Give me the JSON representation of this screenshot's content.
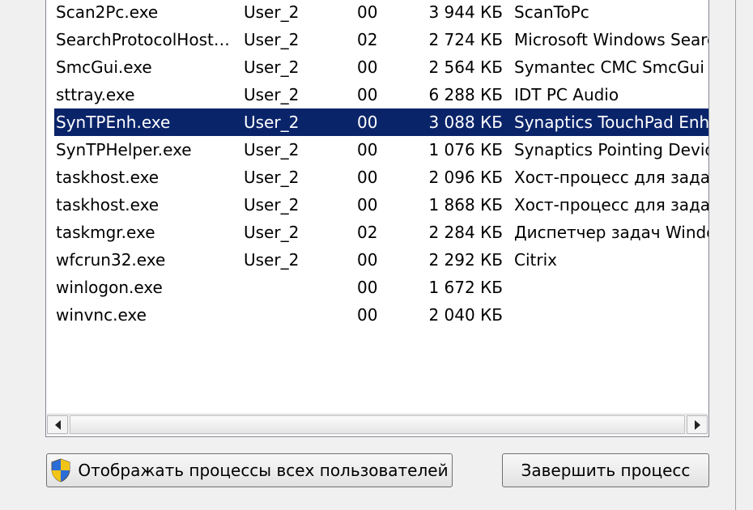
{
  "processes": [
    {
      "name": "Scan2Pc.exe",
      "user": "User_2",
      "session": "00",
      "memory": "3 944 КБ",
      "description": "ScanToPc",
      "selected": false
    },
    {
      "name": "SearchProtocolHost…",
      "user": "User_2",
      "session": "02",
      "memory": "2 724 КБ",
      "description": "Microsoft Windows Searc",
      "selected": false
    },
    {
      "name": "SmcGui.exe",
      "user": "User_2",
      "session": "00",
      "memory": "2 564 КБ",
      "description": "Symantec CMC SmcGui",
      "selected": false
    },
    {
      "name": "sttray.exe",
      "user": "User_2",
      "session": "00",
      "memory": "6 288 КБ",
      "description": "IDT PC Audio",
      "selected": false
    },
    {
      "name": "SynTPEnh.exe",
      "user": "User_2",
      "session": "00",
      "memory": "3 088 КБ",
      "description": "Synaptics TouchPad Enha",
      "selected": true
    },
    {
      "name": "SynTPHelper.exe",
      "user": "User_2",
      "session": "00",
      "memory": "1 076 КБ",
      "description": "Synaptics Pointing Device",
      "selected": false
    },
    {
      "name": "taskhost.exe",
      "user": "User_2",
      "session": "00",
      "memory": "2 096 КБ",
      "description": "Хост-процесс для задач",
      "selected": false
    },
    {
      "name": "taskhost.exe",
      "user": "User_2",
      "session": "00",
      "memory": "1 868 КБ",
      "description": "Хост-процесс для задач",
      "selected": false
    },
    {
      "name": "taskmgr.exe",
      "user": "User_2",
      "session": "02",
      "memory": "2 284 КБ",
      "description": "Диспетчер задач Windo",
      "selected": false
    },
    {
      "name": "wfcrun32.exe",
      "user": "User_2",
      "session": "00",
      "memory": "2 292 КБ",
      "description": "Citrix",
      "selected": false
    },
    {
      "name": "winlogon.exe",
      "user": "",
      "session": "00",
      "memory": "1 672 КБ",
      "description": "",
      "selected": false
    },
    {
      "name": "winvnc.exe",
      "user": "",
      "session": "00",
      "memory": "2 040 КБ",
      "description": "",
      "selected": false
    }
  ],
  "buttons": {
    "show_all_label": "Отображать процессы всех пользователей",
    "end_process_label": "Завершить процесс"
  },
  "icons": {
    "shield": "uac-shield-icon",
    "scroll_left": "scroll-left-arrow-icon",
    "scroll_right": "scroll-right-arrow-icon"
  },
  "colors": {
    "selection": "#0a246a",
    "selection_text": "#ffffff"
  }
}
